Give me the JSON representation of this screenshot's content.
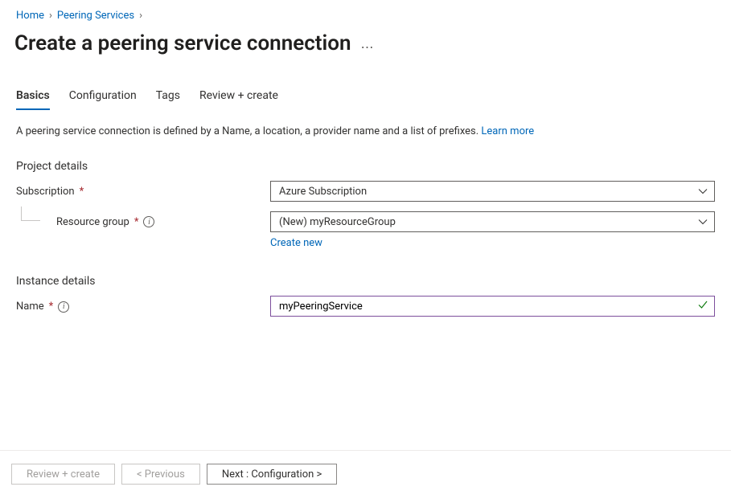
{
  "breadcrumbs": {
    "home": "Home",
    "peering_services": "Peering Services"
  },
  "page_title": "Create a peering service connection",
  "tabs": {
    "basics": "Basics",
    "configuration": "Configuration",
    "tags": "Tags",
    "review_create": "Review + create"
  },
  "description": {
    "text": "A peering service connection is defined by a Name, a location, a provider name and a list of prefixes. ",
    "learn_more": "Learn more"
  },
  "sections": {
    "project_details": "Project details",
    "instance_details": "Instance details"
  },
  "fields": {
    "subscription": {
      "label": "Subscription",
      "value": "Azure Subscription"
    },
    "resource_group": {
      "label": "Resource group",
      "value": "(New) myResourceGroup",
      "create_new": "Create new"
    },
    "name": {
      "label": "Name",
      "value": "myPeeringService"
    }
  },
  "footer": {
    "review_create": "Review + create",
    "previous": "< Previous",
    "next": "Next : Configuration >"
  }
}
